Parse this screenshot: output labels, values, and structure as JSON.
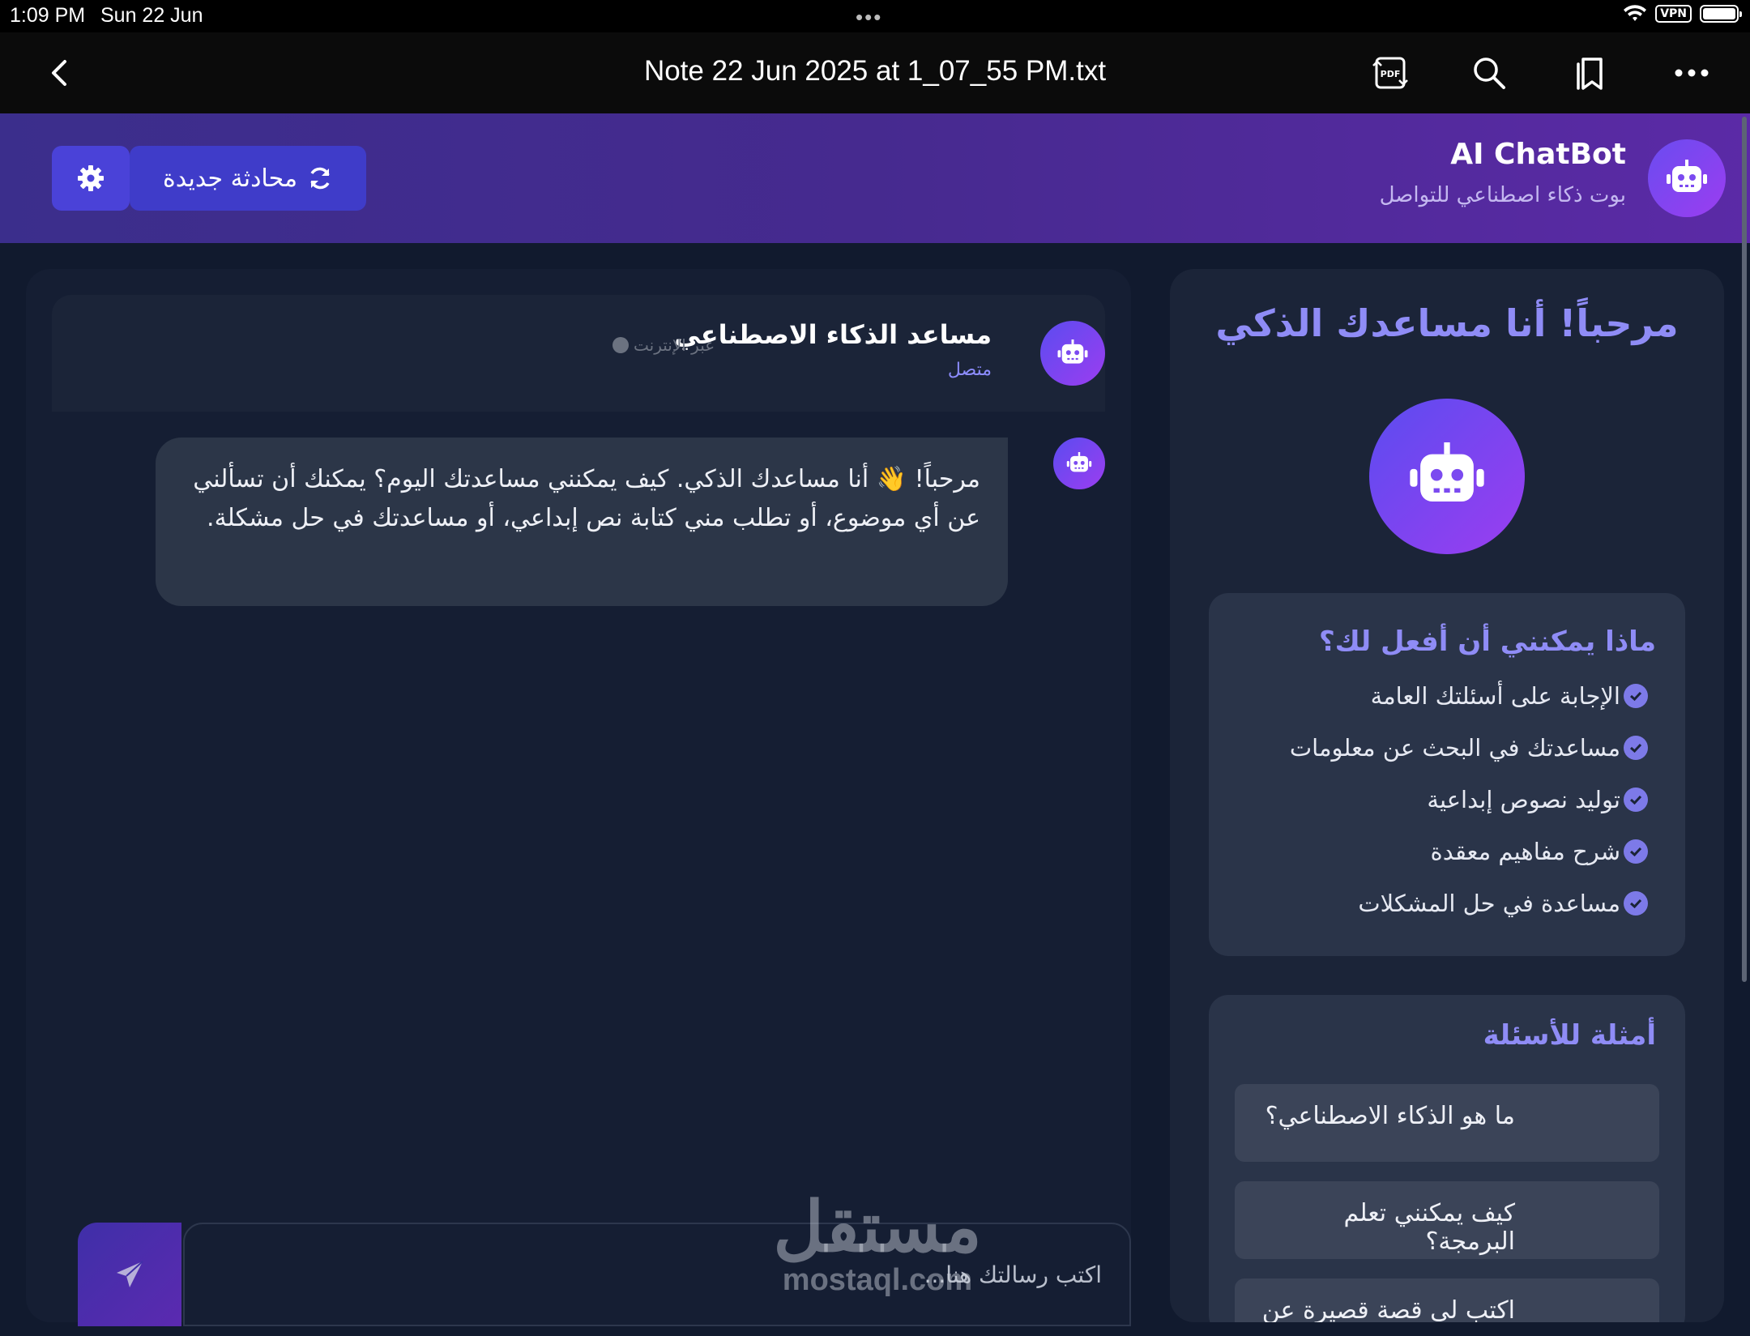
{
  "status_bar": {
    "time": "1:09 PM",
    "date": "Sun 22 Jun",
    "vpn": "VPN"
  },
  "toolbar": {
    "document_title": "Note 22 Jun 2025 at 1_07_55 PM.txt",
    "pdf_icon_label": "PDF"
  },
  "header": {
    "brand_title": "AI ChatBot",
    "brand_subtitle": "بوت ذكاء اصطناعي للتواصل",
    "new_chat_label": "محادثة جديدة"
  },
  "chat": {
    "assistant_name": "مساعد الذكاء الاصطناعي",
    "status_online": "متصل",
    "status_offline": "عبر الإنترنت",
    "messages": [
      {
        "sender": "bot",
        "text": "مرحباً! 👋 أنا مساعدك الذكي. كيف يمكنني مساعدتك اليوم؟ يمكنك أن تسألني عن أي موضوع، أو تطلب مني كتابة نص إبداعي، أو مساعدتك في حل مشكلة."
      }
    ],
    "input_placeholder": "اكتب رسالتك هنا..."
  },
  "watermark": {
    "arabic": "مستقل",
    "latin": "mostaql.com"
  },
  "sidebar": {
    "welcome_title": "مرحباً! أنا مساعدك الذكي",
    "features_title": "ماذا يمكنني أن أفعل لك؟",
    "features": [
      "الإجابة على أسئلتك العامة",
      "مساعدتك في البحث عن معلومات",
      "توليد نصوص إبداعية",
      "شرح مفاهيم معقدة",
      "مساعدة في حل المشكلات"
    ],
    "examples_title": "أمثلة للأسئلة",
    "examples": [
      "ما هو الذكاء الاصطناعي؟",
      "كيف يمكنني تعلم البرمجة؟",
      "اكتب لي قصة قصيرة عن المستقبل"
    ]
  },
  "colors": {
    "accent": "#8f8cf6",
    "brand_gradient_start": "#3b2e8c",
    "brand_gradient_end": "#5b2aa6",
    "background": "#111a2e"
  }
}
